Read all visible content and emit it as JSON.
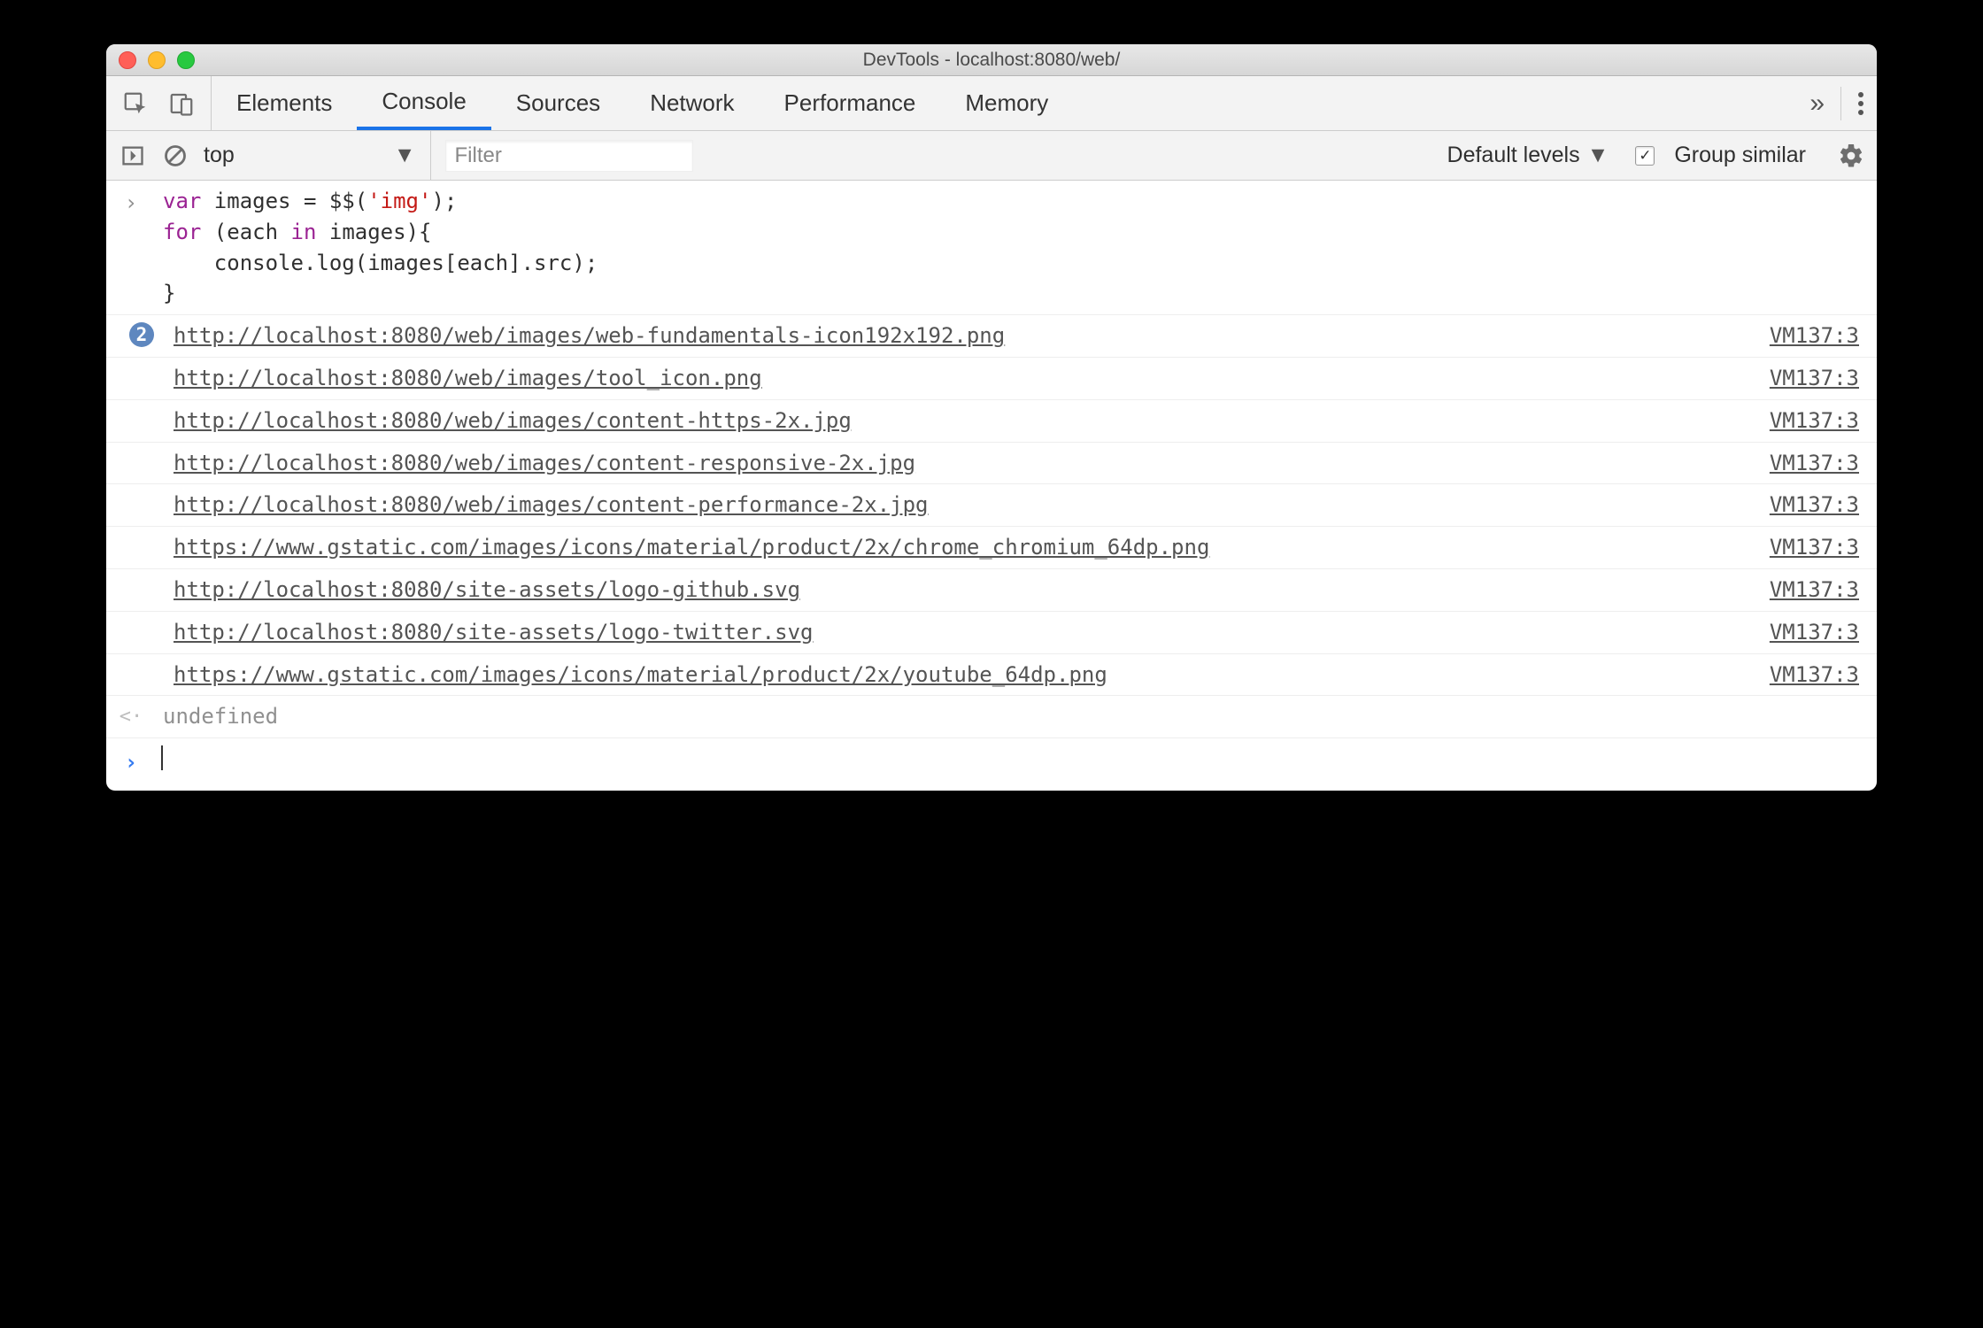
{
  "window": {
    "title": "DevTools - localhost:8080/web/"
  },
  "tabs": {
    "items": [
      "Elements",
      "Console",
      "Sources",
      "Network",
      "Performance",
      "Memory"
    ],
    "active_index": 1
  },
  "toolbar": {
    "context": "top",
    "filter_placeholder": "Filter",
    "levels_label": "Default levels",
    "group_checked": true,
    "group_label": "Group similar"
  },
  "code": {
    "line1_pre": "var",
    "line1_mid": " images = $$(",
    "line1_str": "'img'",
    "line1_end": ");",
    "line2_a": "for",
    "line2_b": " (each ",
    "line2_c": "in",
    "line2_d": " images){",
    "line3": "    console.log(images[each].src);",
    "line4": "}"
  },
  "logs": [
    {
      "badge": "2",
      "url": "http://localhost:8080/web/images/web-fundamentals-icon192x192.png",
      "src": "VM137:3"
    },
    {
      "badge": "",
      "url": "http://localhost:8080/web/images/tool_icon.png",
      "src": "VM137:3"
    },
    {
      "badge": "",
      "url": "http://localhost:8080/web/images/content-https-2x.jpg",
      "src": "VM137:3"
    },
    {
      "badge": "",
      "url": "http://localhost:8080/web/images/content-responsive-2x.jpg",
      "src": "VM137:3"
    },
    {
      "badge": "",
      "url": "http://localhost:8080/web/images/content-performance-2x.jpg",
      "src": "VM137:3"
    },
    {
      "badge": "",
      "url": "https://www.gstatic.com/images/icons/material/product/2x/chrome_chromium_64dp.png",
      "src": "VM137:3"
    },
    {
      "badge": "",
      "url": "http://localhost:8080/site-assets/logo-github.svg",
      "src": "VM137:3"
    },
    {
      "badge": "",
      "url": "http://localhost:8080/site-assets/logo-twitter.svg",
      "src": "VM137:3"
    },
    {
      "badge": "",
      "url": "https://www.gstatic.com/images/icons/material/product/2x/youtube_64dp.png",
      "src": "VM137:3"
    }
  ],
  "return_value": "undefined"
}
